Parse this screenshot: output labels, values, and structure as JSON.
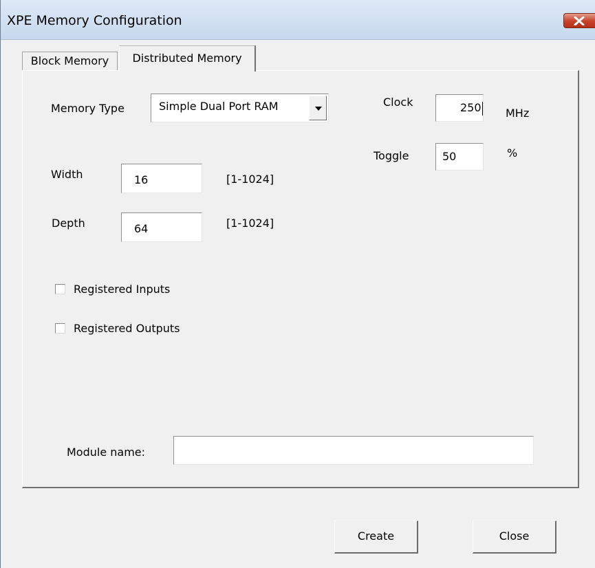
{
  "window": {
    "title": "XPE Memory Configuration"
  },
  "tabs": [
    {
      "label": "Block Memory",
      "selected": false
    },
    {
      "label": "Distributed Memory",
      "selected": true
    }
  ],
  "form": {
    "memory_type": {
      "label": "Memory Type",
      "value": "Simple Dual Port RAM"
    },
    "clock": {
      "label": "Clock",
      "value": "250",
      "unit": "MHz"
    },
    "toggle": {
      "label": "Toggle",
      "value": "50",
      "unit": "%"
    },
    "width": {
      "label": "Width",
      "value": "16",
      "range": "[1-1024]"
    },
    "depth": {
      "label": "Depth",
      "value": "64",
      "range": "[1-1024]"
    },
    "registered_inputs": {
      "label": "Registered Inputs",
      "checked": false
    },
    "registered_outputs": {
      "label": "Registered Outputs",
      "checked": false
    },
    "module_name": {
      "label": "Module name:",
      "value": ""
    }
  },
  "buttons": {
    "create_label": "Create",
    "close_label": "Close"
  },
  "icons": {
    "title_close": "close-icon",
    "combo_arrow": "chevron-down-icon"
  },
  "colors": {
    "titlebar": "#c7d9ee",
    "close_button": "#c8412a",
    "dialog_bg": "#f0f0f0"
  }
}
